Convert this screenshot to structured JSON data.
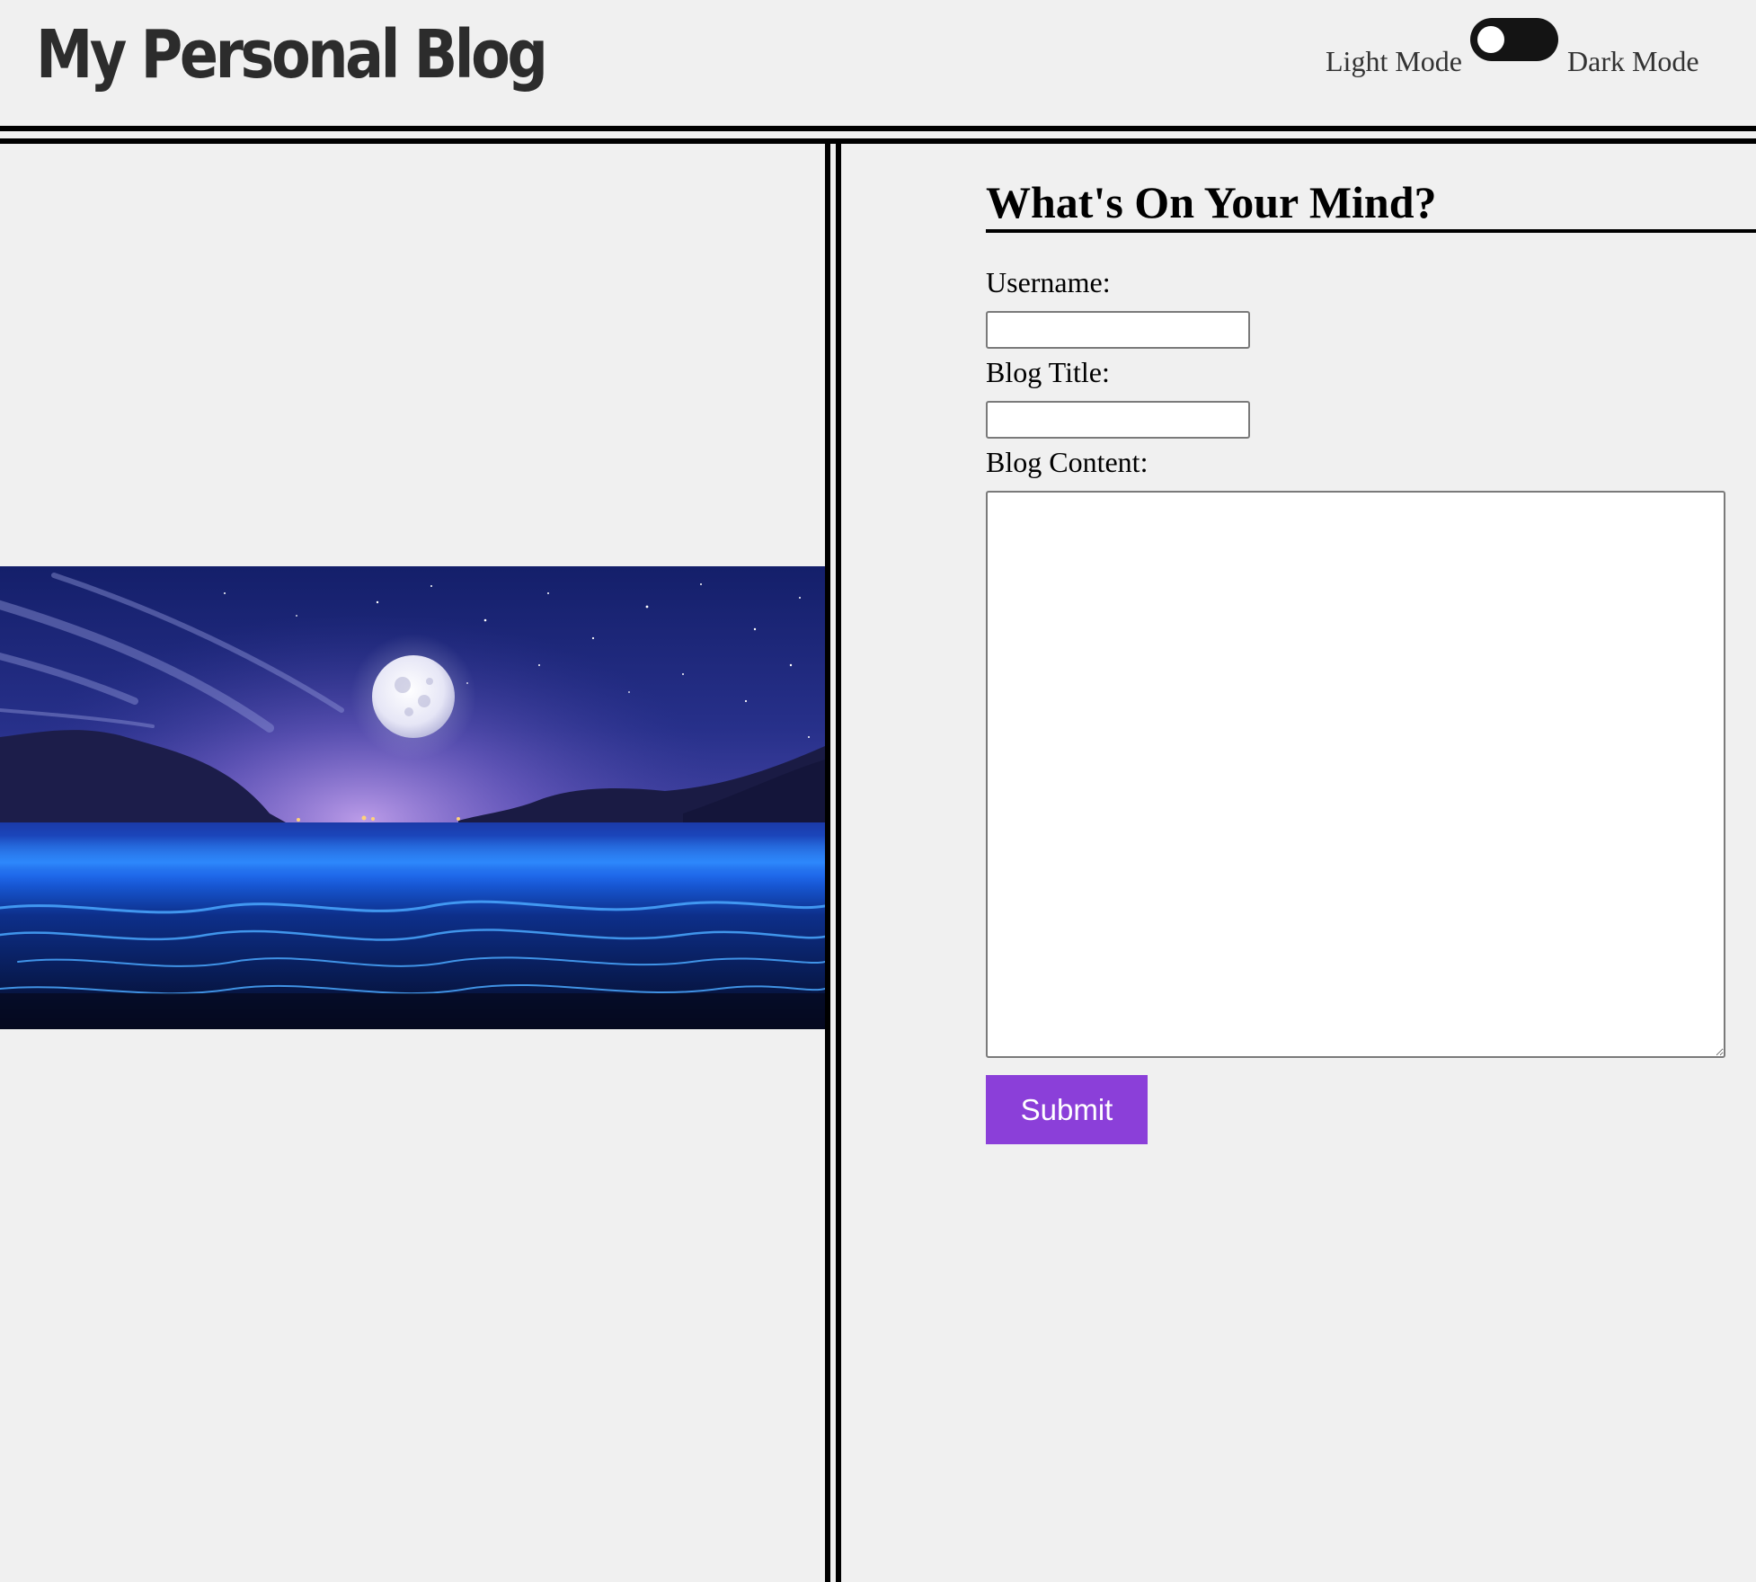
{
  "header": {
    "title": "My Personal Blog",
    "theme_toggle": {
      "left_label": "Light Mode",
      "right_label": "Dark Mode",
      "state": "light"
    }
  },
  "form": {
    "heading": "What's On Your Mind?",
    "username_label": "Username:",
    "username_value": "",
    "title_label": "Blog Title:",
    "title_value": "",
    "content_label": "Blog Content:",
    "content_value": "",
    "submit_label": "Submit"
  },
  "colors": {
    "page_background": "#f0f0f0",
    "submit_button": "#8b3fd9",
    "toggle_track": "#141414",
    "rules": "#000000"
  },
  "icons": {
    "theme_toggle": "toggle-switch-icon"
  }
}
